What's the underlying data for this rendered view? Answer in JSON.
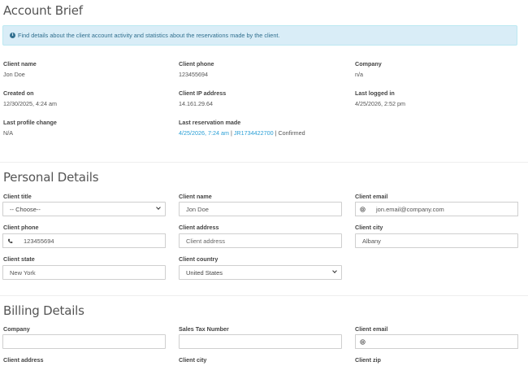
{
  "account_brief": {
    "title": "Account Brief",
    "info_text": "Find details about the client account activity and statistics about the reservations made by the client.",
    "fields": {
      "client_name": {
        "label": "Client name",
        "value": "Jon Doe"
      },
      "client_phone": {
        "label": "Client phone",
        "value": "123455694"
      },
      "company": {
        "label": "Company",
        "value": "n/a"
      },
      "created_on": {
        "label": "Created on",
        "value": "12/30/2025, 4:24 am"
      },
      "client_ip": {
        "label": "Client IP address",
        "value": "14.161.29.64"
      },
      "last_logged_in": {
        "label": "Last logged in",
        "value": "4/25/2026, 2:52 pm"
      },
      "last_profile_change": {
        "label": "Last profile change",
        "value": "N/A"
      },
      "last_reservation": {
        "label": "Last reservation made",
        "date": "4/25/2026, 7:24 am",
        "reservation_id": "JR1734422700",
        "status": "Confirmed",
        "separator": "|"
      }
    }
  },
  "personal_details": {
    "title": "Personal Details",
    "client_title": {
      "label": "Client title",
      "value": "-- Choose--"
    },
    "client_name": {
      "label": "Client name",
      "value": "Jon Doe"
    },
    "client_email": {
      "label": "Client email",
      "value": "jon.email@company.com"
    },
    "client_phone": {
      "label": "Client phone",
      "value": "123455694"
    },
    "client_address": {
      "label": "Client address",
      "placeholder": "Client address"
    },
    "client_city": {
      "label": "Client city",
      "value": "Albany"
    },
    "client_state": {
      "label": "Client state",
      "value": "New York"
    },
    "client_country": {
      "label": "Client country",
      "value": "United States"
    }
  },
  "billing_details": {
    "title": "Billing Details",
    "company": {
      "label": "Company",
      "value": ""
    },
    "sales_tax_number": {
      "label": "Sales Tax Number",
      "value": ""
    },
    "client_email": {
      "label": "Client email",
      "value": ""
    },
    "client_address": {
      "label": "Client address"
    },
    "client_city": {
      "label": "Client city"
    },
    "client_zip": {
      "label": "Client zip"
    }
  },
  "icons": {
    "info": "info-circle-icon",
    "phone": "phone-icon",
    "email": "at-sign-icon",
    "dropdown": "chevron-down-icon"
  },
  "colors": {
    "link": "#2a9fd6",
    "alert_bg": "#d9edf7",
    "alert_text": "#31708f"
  }
}
